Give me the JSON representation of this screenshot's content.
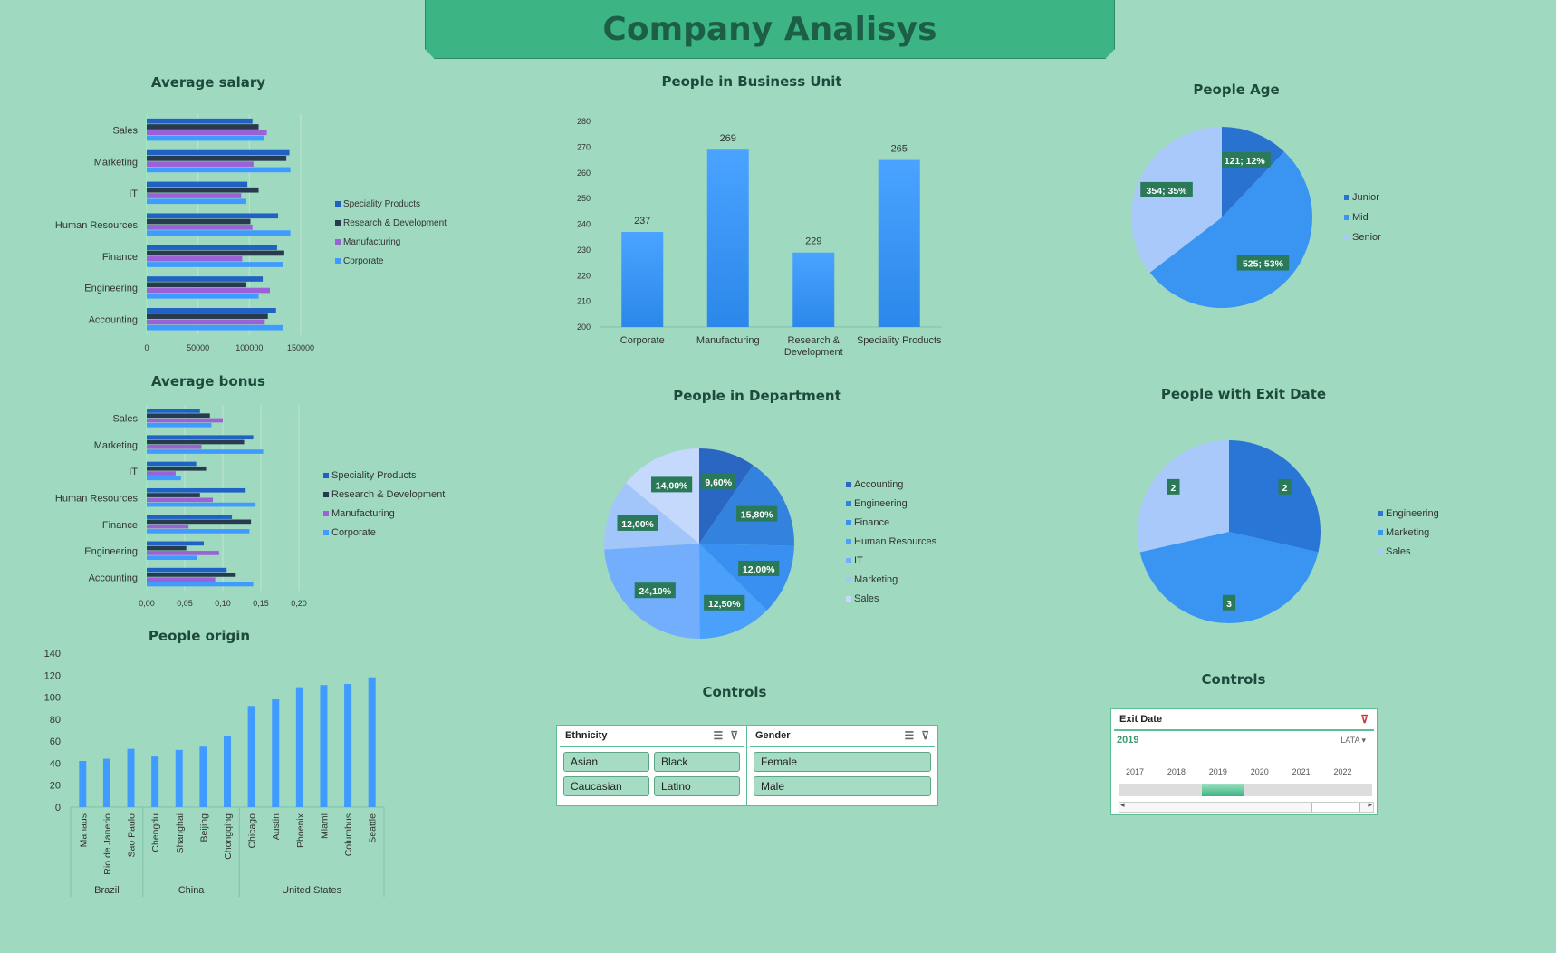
{
  "header": {
    "title": "Company Analisys"
  },
  "colors": {
    "background": "#9fd9c0",
    "banner": "#3cb483",
    "speciality": "#1f62c4",
    "rnd": "#283a4e",
    "manufacturing": "#9b61d6",
    "corporate": "#3f9bff",
    "label_box": "#2a7a5a"
  },
  "controls_left": {
    "title": "Controls",
    "ethnicity": {
      "label": "Ethnicity",
      "options": [
        "Asian",
        "Black",
        "Caucasian",
        "Latino"
      ]
    },
    "gender": {
      "label": "Gender",
      "options": [
        "Female",
        "Male"
      ]
    }
  },
  "controls_right": {
    "title": "Controls",
    "exit_date": {
      "label": "Exit Date",
      "selected_year": "2019",
      "level": "LATA",
      "years": [
        "2017",
        "2018",
        "2019",
        "2020",
        "2021",
        "2022"
      ]
    }
  },
  "chart_data": [
    {
      "id": "avg_salary",
      "type": "bar",
      "orientation": "horizontal",
      "title": "Average salary",
      "categories": [
        "Sales",
        "Marketing",
        "IT",
        "Human Resources",
        "Finance",
        "Engineering",
        "Accounting"
      ],
      "series": [
        {
          "name": "Speciality Products",
          "color": "#1f62c4",
          "values": [
            103000,
            139000,
            98000,
            128000,
            127000,
            113000,
            126000
          ]
        },
        {
          "name": "Research & Development",
          "color": "#283a4e",
          "values": [
            109000,
            136000,
            109000,
            101000,
            134000,
            97000,
            118000
          ]
        },
        {
          "name": "Manufacturing",
          "color": "#9b61d6",
          "values": [
            117000,
            104000,
            92000,
            103000,
            93000,
            120000,
            115000
          ]
        },
        {
          "name": "Corporate",
          "color": "#3f9bff",
          "values": [
            114000,
            140000,
            97000,
            140000,
            133000,
            109000,
            133000
          ]
        }
      ],
      "xlim": [
        0,
        150000
      ],
      "xticks": [
        "0",
        "50000",
        "100000",
        "150000"
      ],
      "legend": "right"
    },
    {
      "id": "avg_bonus",
      "type": "bar",
      "orientation": "horizontal",
      "title": "Average bonus",
      "categories": [
        "Sales",
        "Marketing",
        "IT",
        "Human Resources",
        "Finance",
        "Engineering",
        "Accounting"
      ],
      "series": [
        {
          "name": "Speciality Products",
          "color": "#1f62c4",
          "values": [
            0.07,
            0.14,
            0.065,
            0.13,
            0.112,
            0.075,
            0.105
          ]
        },
        {
          "name": "Research & Development",
          "color": "#283a4e",
          "values": [
            0.083,
            0.128,
            0.078,
            0.07,
            0.137,
            0.052,
            0.117
          ]
        },
        {
          "name": "Manufacturing",
          "color": "#9b61d6",
          "values": [
            0.1,
            0.072,
            0.038,
            0.087,
            0.055,
            0.095,
            0.09
          ]
        },
        {
          "name": "Corporate",
          "color": "#3f9bff",
          "values": [
            0.085,
            0.153,
            0.045,
            0.143,
            0.135,
            0.066,
            0.14
          ]
        }
      ],
      "xlim": [
        0,
        0.2
      ],
      "xticks": [
        "0,00",
        "0,05",
        "0,10",
        "0,15",
        "0,20"
      ],
      "legend": "right"
    },
    {
      "id": "people_origin",
      "type": "bar",
      "title": "People origin",
      "groups": [
        {
          "name": "Brazil",
          "categories": [
            "Manaus",
            "Rio de Janerio",
            "Sao Paulo"
          ]
        },
        {
          "name": "China",
          "categories": [
            "Chengdu",
            "Shanghai",
            "Beijing",
            "Chongqing"
          ]
        },
        {
          "name": "United States",
          "categories": [
            "Chicago",
            "Austin",
            "Phoenix",
            "Miami",
            "Columbus",
            "Seattle"
          ]
        }
      ],
      "categories": [
        "Manaus",
        "Rio de Janerio",
        "Sao Paulo",
        "Chengdu",
        "Shanghai",
        "Beijing",
        "Chongqing",
        "Chicago",
        "Austin",
        "Phoenix",
        "Miami",
        "Columbus",
        "Seattle"
      ],
      "values": [
        42,
        44,
        53,
        46,
        52,
        55,
        65,
        92,
        98,
        109,
        111,
        112,
        118
      ],
      "ylim": [
        0,
        140
      ],
      "yticks": [
        "0",
        "20",
        "40",
        "60",
        "80",
        "100",
        "120",
        "140"
      ]
    },
    {
      "id": "people_bu",
      "type": "bar",
      "title": "People in Business Unit",
      "categories": [
        "Corporate",
        "Manufacturing",
        "Research & Development",
        "Speciality Products"
      ],
      "category_lines": [
        [
          "Corporate"
        ],
        [
          "Manufacturing"
        ],
        [
          "Research &",
          "Development"
        ],
        [
          "Speciality Products"
        ]
      ],
      "values": [
        237,
        269,
        229,
        265
      ],
      "value_labels": [
        "237",
        "269",
        "229",
        "265"
      ],
      "ylim": [
        200,
        280
      ],
      "yticks": [
        "200",
        "210",
        "220",
        "230",
        "240",
        "250",
        "260",
        "270",
        "280"
      ]
    },
    {
      "id": "people_age",
      "type": "pie",
      "title": "People Age",
      "slices": [
        {
          "name": "Junior",
          "value": 121,
          "label": "121; 12%",
          "color": "#2a72d0"
        },
        {
          "name": "Mid",
          "value": 525,
          "label": "525; 53%",
          "color": "#3a95f2"
        },
        {
          "name": "Senior",
          "value": 354,
          "label": "354; 35%",
          "color": "#a9c9fb"
        }
      ],
      "legend": "right"
    },
    {
      "id": "people_department",
      "type": "pie",
      "title": "People in Department",
      "slices": [
        {
          "name": "Accounting",
          "value": 9.6,
          "label": "9,60%",
          "color": "#2a67c2"
        },
        {
          "name": "Engineering",
          "value": 15.8,
          "label": "15,80%",
          "color": "#3282de"
        },
        {
          "name": "Finance",
          "value": 12.0,
          "label": "12,00%",
          "color": "#3a90f0"
        },
        {
          "name": "Human Resources",
          "value": 12.5,
          "label": "12,50%",
          "color": "#4aa0fb"
        },
        {
          "name": "IT",
          "value": 24.1,
          "label": "24,10%",
          "color": "#72aefb"
        },
        {
          "name": "Marketing",
          "value": 12.0,
          "label": "12,00%",
          "color": "#a2c6fa"
        },
        {
          "name": "Sales",
          "value": 14.0,
          "label": "14,00%",
          "color": "#c4d9fc"
        }
      ],
      "legend": "right"
    },
    {
      "id": "people_exit",
      "type": "pie",
      "title": "People with Exit Date",
      "slices": [
        {
          "name": "Engineering",
          "value": 2,
          "label": "2",
          "color": "#2a76d6"
        },
        {
          "name": "Marketing",
          "value": 3,
          "label": "3",
          "color": "#3a95f2"
        },
        {
          "name": "Sales",
          "value": 2,
          "label": "2",
          "color": "#a9c9fb"
        }
      ],
      "legend": "right"
    }
  ]
}
